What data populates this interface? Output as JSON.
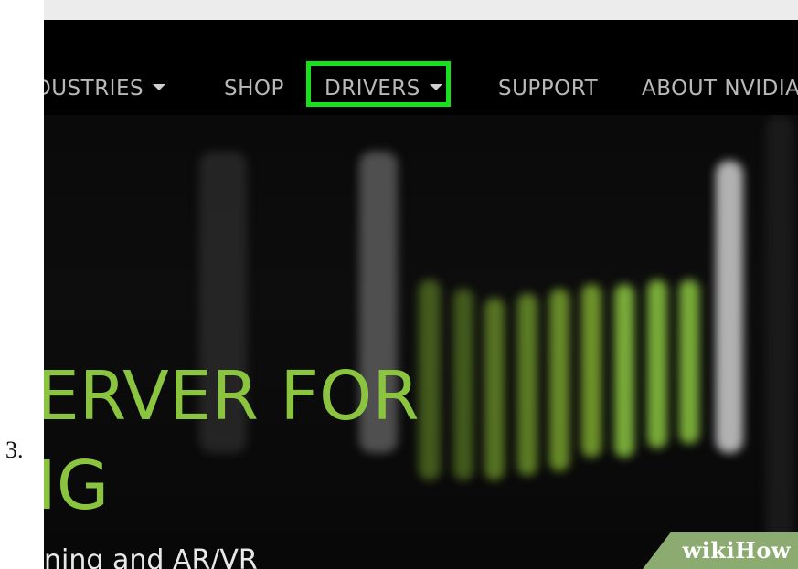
{
  "step": {
    "number": "3."
  },
  "navigation": {
    "items": [
      {
        "label": "DUSTRIES",
        "has_dropdown": true
      },
      {
        "label": "SHOP",
        "has_dropdown": false
      },
      {
        "label": "DRIVERS",
        "has_dropdown": true,
        "highlighted": true
      },
      {
        "label": "SUPPORT",
        "has_dropdown": false
      },
      {
        "label": "ABOUT NVIDIA",
        "has_dropdown": false
      }
    ]
  },
  "hero": {
    "title_line1": "ERVER FOR",
    "title_line2": "IG",
    "subtitle": "ning and AR/VR"
  },
  "watermark": {
    "text_prefix": "wiki",
    "text_suffix": "How"
  },
  "colors": {
    "accent_green": "#8bc53f",
    "highlight_green": "#16e11c",
    "nav_text": "#b9b9b9",
    "background": "#050505"
  },
  "icons": {
    "dropdown": "caret-down-icon"
  }
}
